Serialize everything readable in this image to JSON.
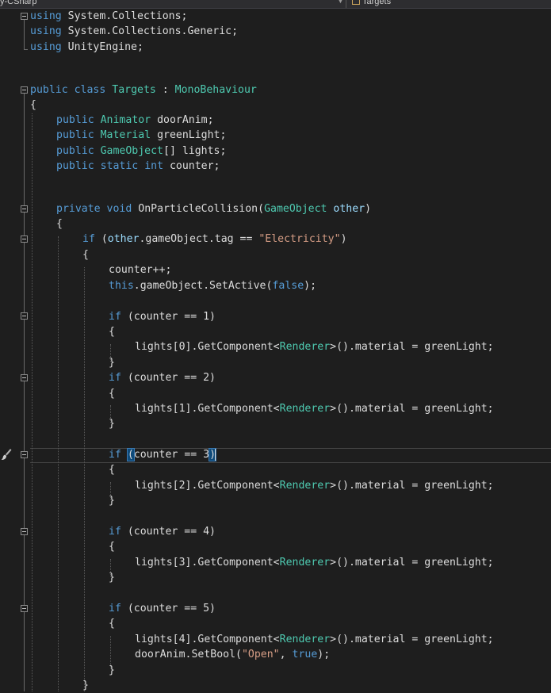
{
  "top_bar": {
    "left_label": "y-CSharp",
    "right_label": "Targets"
  },
  "icons": {
    "fold": "collapse-box-icon",
    "breakpoint_brush": "paint-brush-icon",
    "class_item": "class-icon",
    "dropdown": "chevron-down-icon"
  },
  "colors": {
    "background": "#1e1e1e",
    "keyword": "#569cd6",
    "type": "#4ec9b0",
    "string": "#d69d85",
    "text": "#dcdcdc"
  },
  "code": {
    "l1": {
      "t1": "using",
      "t2": " System.Collections;"
    },
    "l2": {
      "t1": "using",
      "t2": " System.Collections.Generic;"
    },
    "l3": {
      "t1": "using",
      "t2": " UnityEngine;"
    },
    "l4": {
      "t1": "public",
      "t2": " ",
      "t3": "class",
      "t4": " ",
      "t5": "Targets",
      "t6": " : ",
      "t7": "MonoBehaviour"
    },
    "l5": "{",
    "l6": {
      "t1": "public",
      "t2": " ",
      "t3": "Animator",
      "t4": " doorAnim;"
    },
    "l7": {
      "t1": "public",
      "t2": " ",
      "t3": "Material",
      "t4": " greenLight;"
    },
    "l8": {
      "t1": "public",
      "t2": " ",
      "t3": "GameObject",
      "t4": "[] lights;"
    },
    "l9": {
      "t1": "public",
      "t2": " ",
      "t3": "static",
      "t4": " ",
      "t5": "int",
      "t6": " counter;"
    },
    "l10": {
      "t1": "private",
      "t2": " ",
      "t3": "void",
      "t4": " ",
      "t5": "OnParticleCollision",
      "t6": "(",
      "t7": "GameObject",
      "t8": " ",
      "t9": "other",
      "t10": ")"
    },
    "l11": "{",
    "l12": {
      "t1": "if",
      "t2": " (",
      "t3": "other",
      "t4": ".gameObject.tag == ",
      "t5": "\"Electricity\"",
      "t6": ")"
    },
    "l13": "{",
    "l14": "counter++;",
    "l15": {
      "t1": "this",
      "t2": ".gameObject.SetActive(",
      "t3": "false",
      "t4": ");"
    },
    "if1": {
      "t1": "if",
      "t2": " (counter == 1)"
    },
    "if2": {
      "t1": "if",
      "t2": " (counter == 2)"
    },
    "if3": {
      "t1": "if",
      "t2": " ",
      "t3": "(",
      "t4": "counter == 3",
      "t5": ")"
    },
    "if4": {
      "t1": "if",
      "t2": " (counter == 4)"
    },
    "if5": {
      "t1": "if",
      "t2": " (counter == 5)"
    },
    "open": "{",
    "close": "}",
    "body1": {
      "t1": "lights[0].GetComponent<",
      "t2": "Renderer",
      "t3": ">().material = greenLight;"
    },
    "body2": {
      "t1": "lights[1].GetComponent<",
      "t2": "Renderer",
      "t3": ">().material = greenLight;"
    },
    "body3": {
      "t1": "lights[2].GetComponent<",
      "t2": "Renderer",
      "t3": ">().material = greenLight;"
    },
    "body4": {
      "t1": "lights[3].GetComponent<",
      "t2": "Renderer",
      "t3": ">().material = greenLight;"
    },
    "body5": {
      "t1": "lights[4].GetComponent<",
      "t2": "Renderer",
      "t3": ">().material = greenLight;"
    },
    "door": {
      "t1": "doorAnim.SetBool(",
      "t2": "\"Open\"",
      "t3": ", ",
      "t4": "true",
      "t5": ");"
    }
  }
}
